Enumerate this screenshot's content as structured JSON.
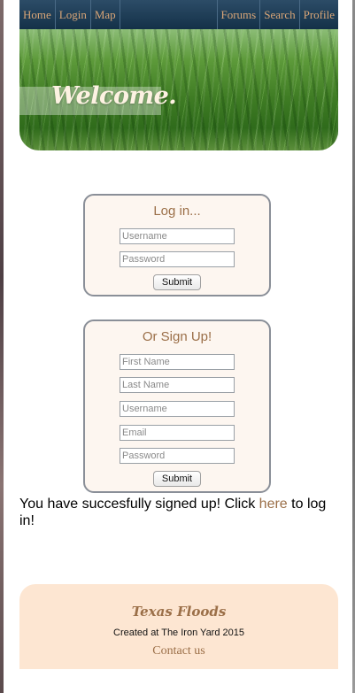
{
  "nav": {
    "left": [
      {
        "id": "home",
        "label": "Home"
      },
      {
        "id": "login",
        "label": "Login"
      },
      {
        "id": "map",
        "label": "Map"
      }
    ],
    "right": [
      {
        "id": "forums",
        "label": "Forums"
      },
      {
        "id": "search",
        "label": "Search"
      },
      {
        "id": "profile",
        "label": "Profile"
      }
    ]
  },
  "hero": {
    "welcome": "Welcome."
  },
  "login_form": {
    "title": "Log in...",
    "username_placeholder": "Username",
    "password_placeholder": "Password",
    "submit_label": "Submit"
  },
  "signup_form": {
    "title": "Or Sign Up!",
    "first_name_placeholder": "First Name",
    "last_name_placeholder": "Last Name",
    "username_placeholder": "Username",
    "email_placeholder": "Email",
    "password_placeholder": "Password",
    "submit_label": "Submit"
  },
  "message": {
    "before": "You have succesfully signed up! Click ",
    "link": "here",
    "after": " to log in!"
  },
  "footer": {
    "title": "Texas Floods",
    "credit": "Created at The Iron Yard 2015",
    "contact": "Contact us"
  },
  "colors": {
    "accent": "#9b6f48",
    "nav_bg": "#143148",
    "nav_text": "#d9a577",
    "form_border": "#8a8f98",
    "footer_bg": "#fde6d2"
  }
}
